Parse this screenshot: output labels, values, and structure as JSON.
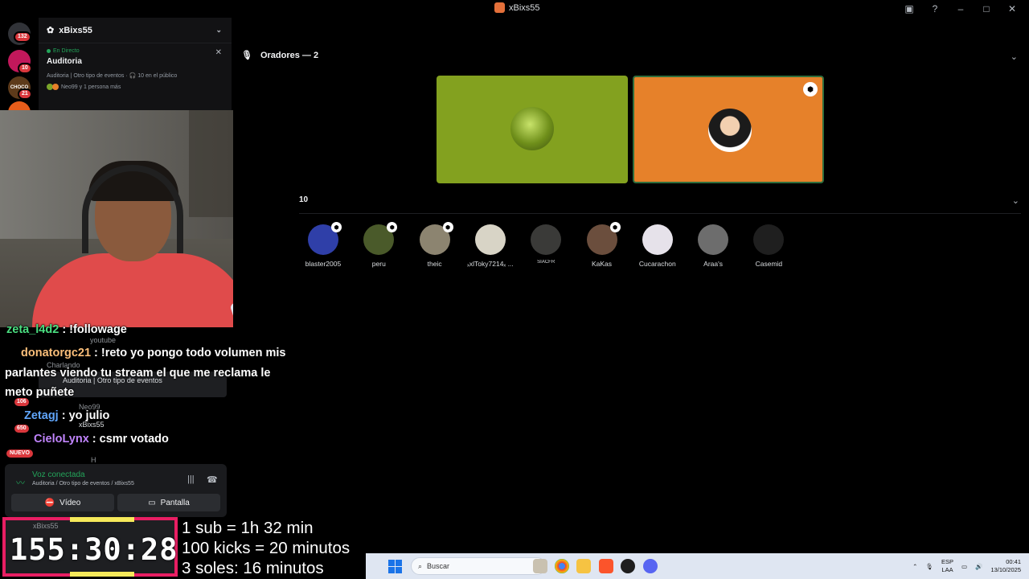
{
  "window": {
    "title": "xBixs55"
  },
  "rail": {
    "badges": [
      "132",
      "10",
      "21"
    ],
    "choco_label": "CHOCO"
  },
  "server": {
    "name": "xBixs55",
    "live_label": "En Directo",
    "event_title": "Auditoria",
    "event_meta": "Auditoria | Otro tipo de eventos · 🎧 10 en el público",
    "event_people": "Neo99 y 1 persona más"
  },
  "stage": {
    "speakers_header": "Oradores — 2",
    "audience_count": "10",
    "audience": [
      {
        "name": "blaster2005",
        "color": "#2f3fa8",
        "mod": true
      },
      {
        "name": "peru",
        "color": "#4a5a2a",
        "mod": true
      },
      {
        "name": "theic",
        "color": "#8c8470",
        "mod": true
      },
      {
        "name": "ₓxlToky7214ₓ ...",
        "color": "#d8d4c6",
        "mod": false
      },
      {
        "name": "SIACFR",
        "color": "#3a3a38",
        "mod": false
      },
      {
        "name": "KaKas",
        "color": "#6b4e3d",
        "mod": true
      },
      {
        "name": "Cucarachon",
        "color": "#e6e2ea",
        "mod": false
      },
      {
        "name": "Araa's",
        "color": "#6d6d6d",
        "mod": false
      },
      {
        "name": "Casemid",
        "color": "#1f1f1f",
        "mod": false
      }
    ]
  },
  "chat": {
    "line1_user": "zeta_l4d2",
    "line1_msg": " : !followage",
    "line2_user": "donatorgc21",
    "line2_msg": " : !reto yo pongo todo volumen mis",
    "line3": "parlantes viendo tu stream el que me reclama le",
    "line4": "meto puñete",
    "line5_user": "Zetagj",
    "line5_msg": " : yo julio",
    "line6_user": "CieloLynx",
    "line6_msg": " : csmr votado",
    "ghost_youtube": "youtube",
    "ghost_charlando": "Charlando",
    "ghost_event": "Auditoria | Otro tipo de eventos",
    "ghost_neo": "Neo99",
    "ghost_xbixs": "xBixs55",
    "ghost_badge_106": "106",
    "ghost_badge_650": "650",
    "ghost_nuevo": "NUEVO",
    "ghost_h": "H"
  },
  "voice": {
    "status": "Voz conectada",
    "subtitle": "Auditoria / Otro tipo de eventos / xBixs55",
    "video_label": "Vídeo",
    "screen_label": "Pantalla"
  },
  "timer": {
    "value": "155:30:28",
    "ghost_user": "xBixs55"
  },
  "subathon_rules": [
    "1 sub = 1h 32 min",
    "100 kicks = 20 minutos",
    "3 soles: 16 minutos"
  ],
  "taskbar": {
    "search_placeholder": "Buscar",
    "lang_top": "ESP",
    "lang_bottom": "LAA",
    "time": "00:41",
    "date": "13/10/2025"
  },
  "colors": {
    "accent_green": "#23a55a",
    "tile_green": "#83a11f",
    "tile_orange": "#e6812a",
    "timer_border": "#e91e63"
  }
}
